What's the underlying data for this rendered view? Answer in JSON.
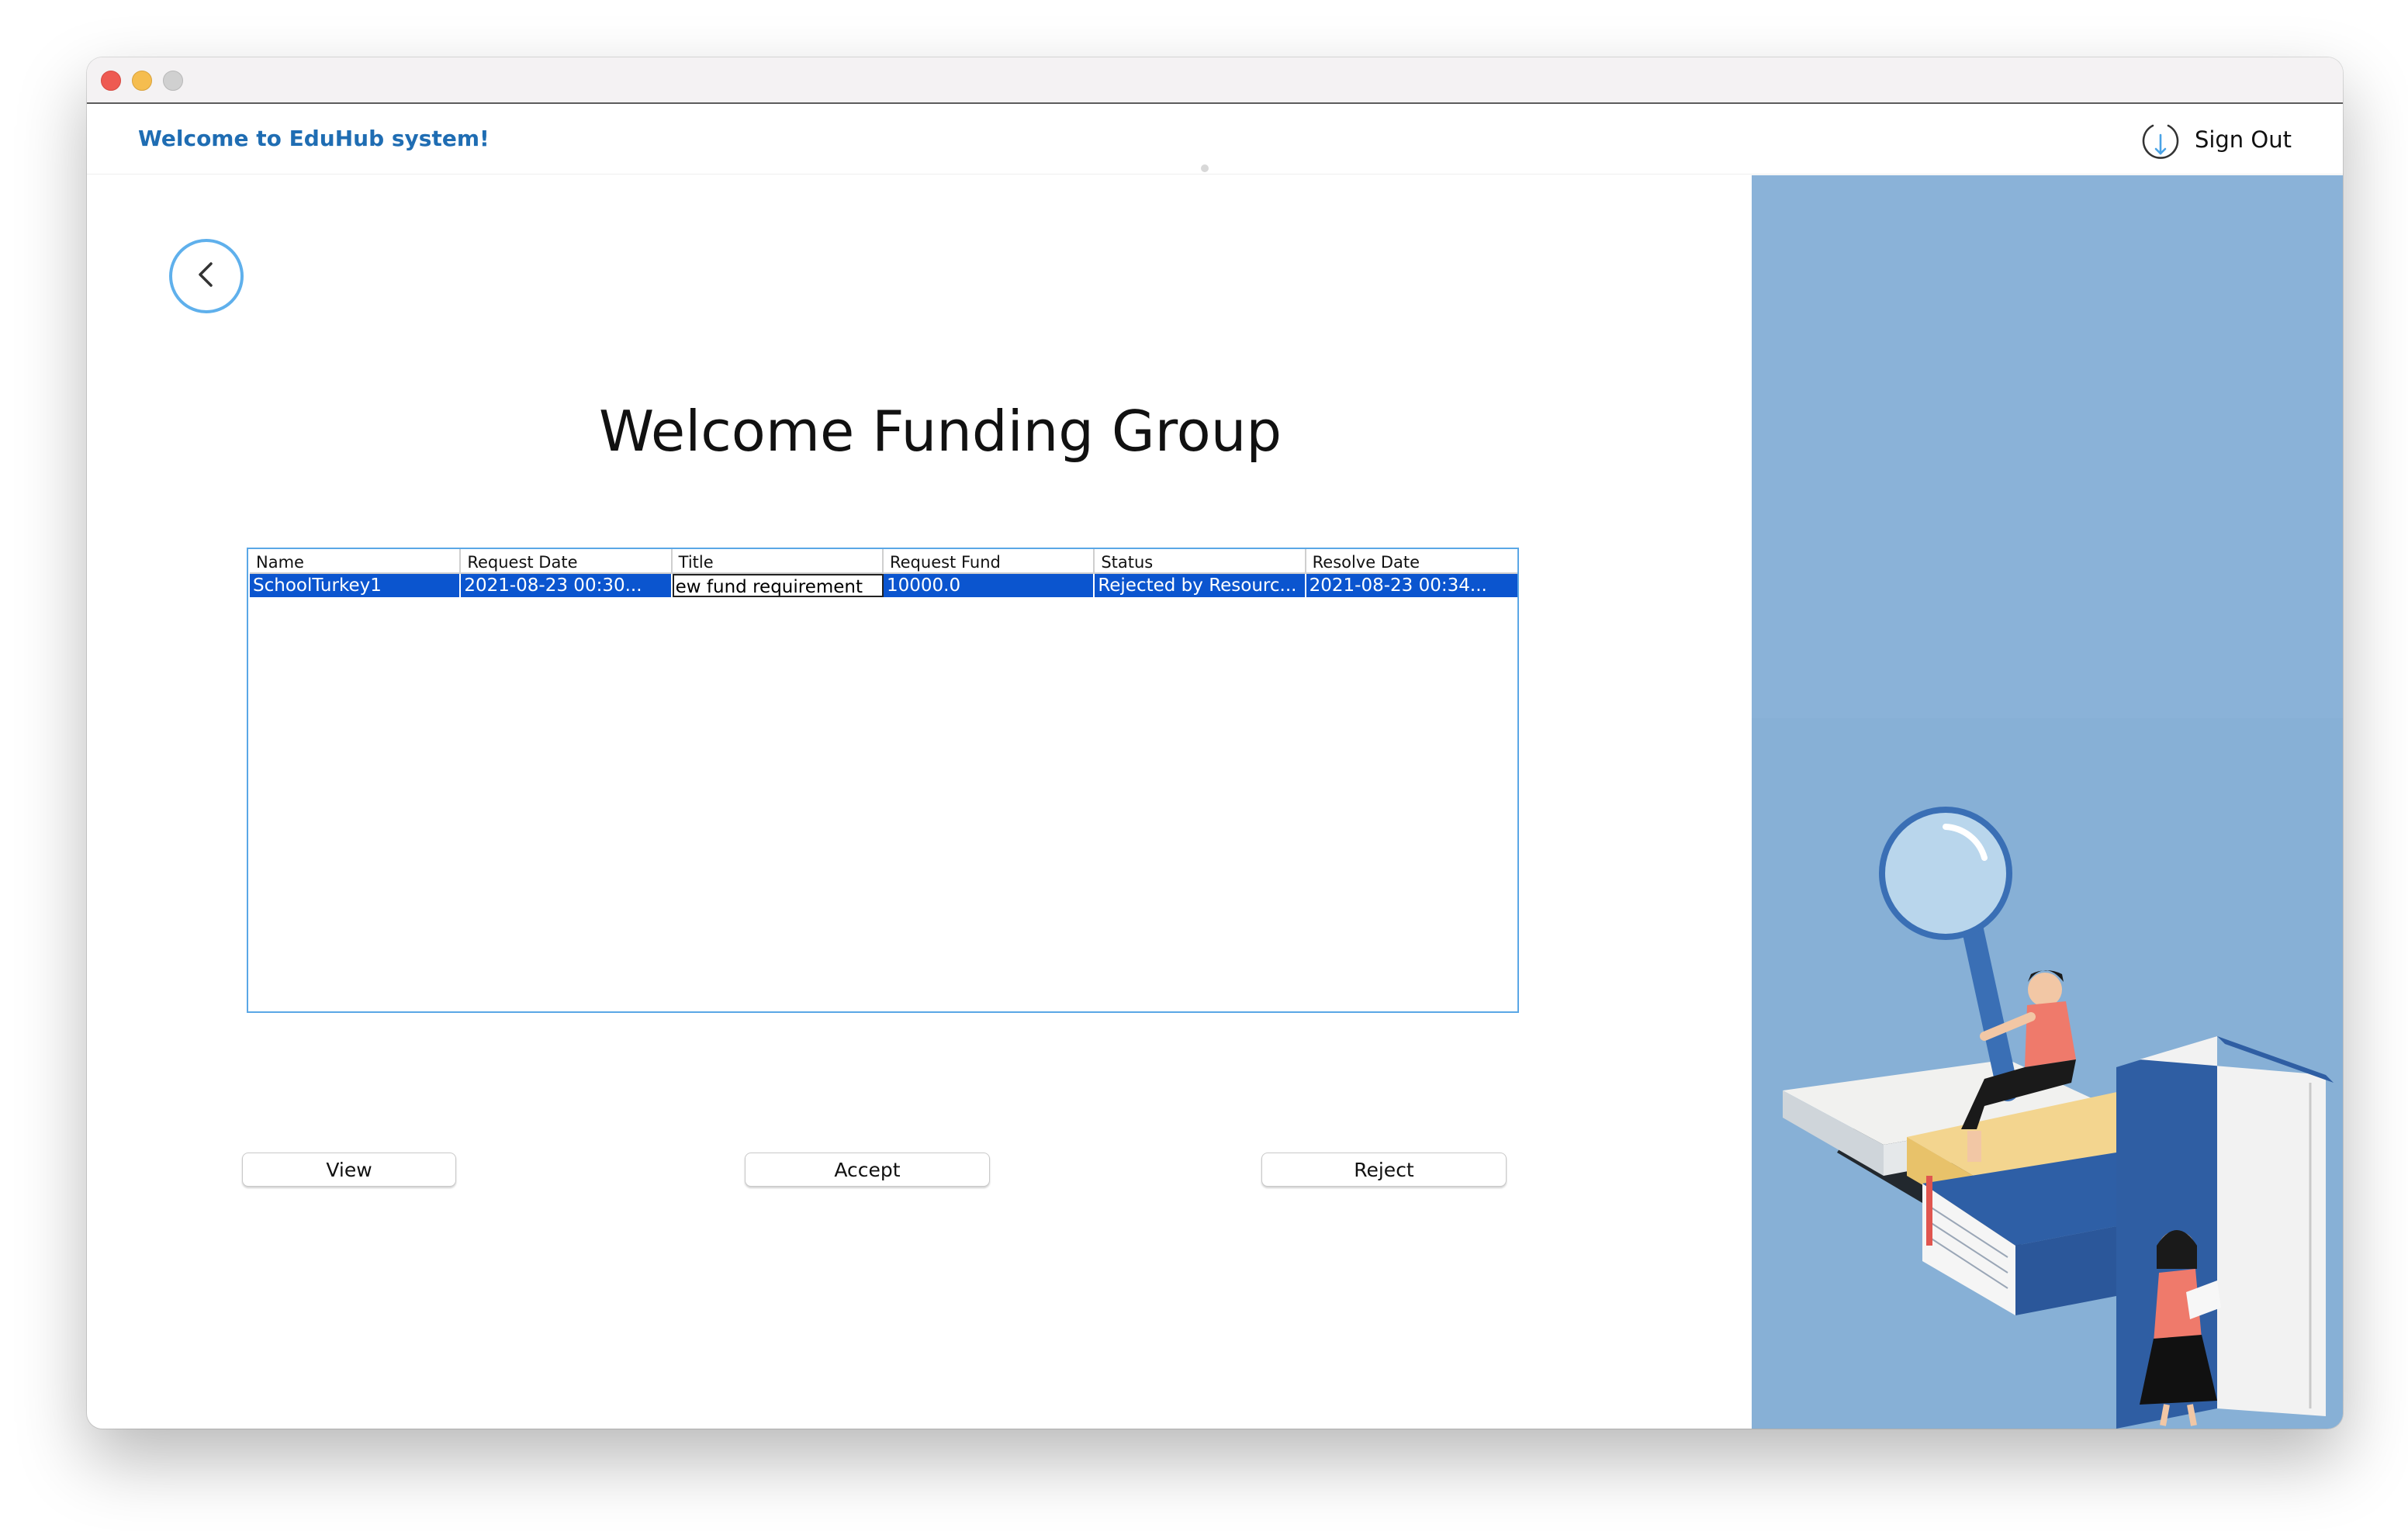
{
  "window": {
    "controls": [
      "close",
      "minimize",
      "zoom"
    ]
  },
  "header": {
    "welcome_text": "Welcome to EduHub system!",
    "signout_label": "Sign Out",
    "signout_icon": "power-icon"
  },
  "main": {
    "back_icon": "chevron-left-icon",
    "title": "Welcome Funding Group"
  },
  "table": {
    "columns": [
      "Name",
      "Request Date",
      "Title",
      "Request Fund",
      "Status",
      "Resolve Date"
    ],
    "rows": [
      {
        "name": "SchoolTurkey1",
        "request_date": "2021-08-23 00:30...",
        "title": "ew fund requirement",
        "request_fund": "10000.0",
        "status": "Rejected by Resourc...",
        "resolve_date": "2021-08-23 00:34..."
      }
    ],
    "selected_row": 0,
    "editing_column": "Title"
  },
  "actions": {
    "view_label": "View",
    "accept_label": "Accept",
    "reject_label": "Reject"
  },
  "colors": {
    "accent": "#1f6db3",
    "selection": "#0b55cf",
    "table_border": "#5aa7e6",
    "illustration_bg": "#87b0d6"
  }
}
